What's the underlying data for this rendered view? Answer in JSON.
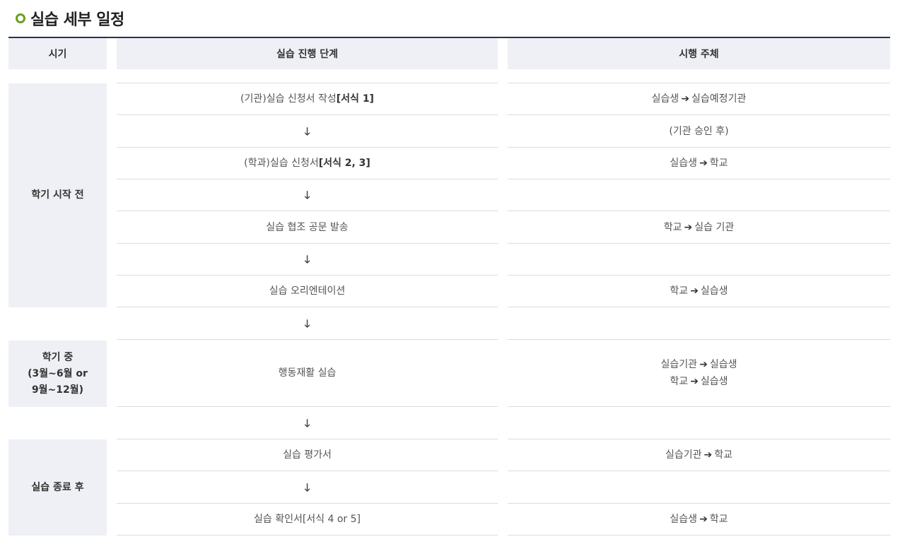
{
  "title": "실습 세부 일정",
  "icons": {
    "title_bullet": "green-ring-icon",
    "flow_right": "arrow-right-icon",
    "flow_down": "arrow-down-icon"
  },
  "colors": {
    "accent": "#6a9f1f",
    "header_line": "#25344a",
    "cell_bg": "#eef0f5"
  },
  "glyphs": {
    "right": "➔",
    "down": "🡓"
  },
  "headers": {
    "period": "시기",
    "step": "실습 진행 단계",
    "actor": "시행 주체"
  },
  "periods": {
    "before": "학기 시작 전",
    "during_1": "학기 중",
    "during_2": "(3월~6월 or",
    "during_3": "9월~12월)",
    "after": "실습 종료 후"
  },
  "rows": {
    "r1": {
      "step_pre": "(기관)실습 신청서 작성",
      "step_bold": "[서식 1]",
      "actor_from": "실습생",
      "actor_to": "실습예정기관"
    },
    "r2": {
      "actor": "(기관 승인 후)"
    },
    "r3": {
      "step_pre": "(학과)실습 신청서",
      "step_bold": "[서식 2, 3]",
      "actor_from": "실습생",
      "actor_to": "학교"
    },
    "r5": {
      "step": "실습 협조 공문 발송",
      "actor_from": "학교",
      "actor_to": "실습 기관"
    },
    "r7": {
      "step": "실습 오리엔테이션",
      "actor_from": "학교",
      "actor_to": "실습생"
    },
    "r9": {
      "step": "행동재활 실습",
      "actor1_from": "실습기관",
      "actor1_to": "실습생",
      "actor2_from": "학교",
      "actor2_to": "실습생"
    },
    "r11": {
      "step": "실습 평가서",
      "actor_from": "실습기관",
      "actor_to": "학교"
    },
    "r13": {
      "step": "실습 확인서[서식 4 or 5]",
      "actor_from": "실습생",
      "actor_to": "학교"
    }
  }
}
